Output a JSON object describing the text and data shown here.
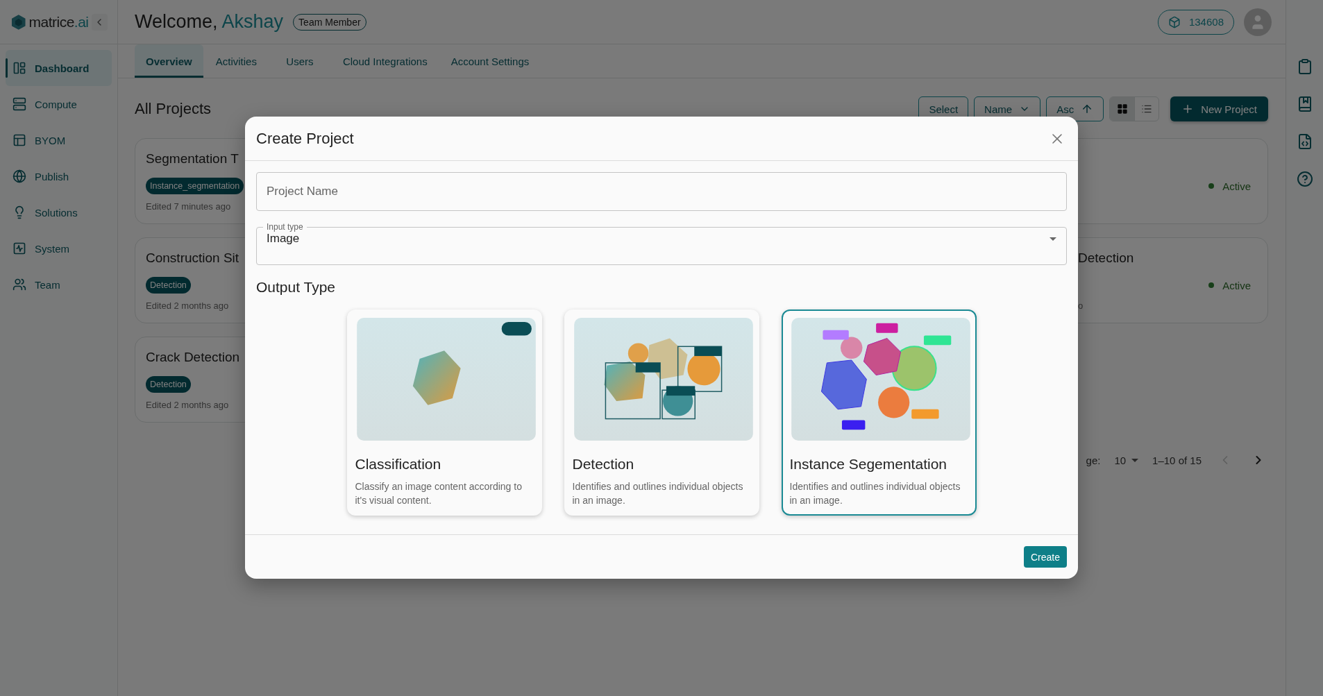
{
  "sidebar": {
    "logo": {
      "name": "matrice",
      "suffix": ".ai"
    },
    "items": [
      {
        "label": "Dashboard",
        "selected": true
      },
      {
        "label": "Compute",
        "selected": false
      },
      {
        "label": "BYOM",
        "selected": false
      },
      {
        "label": "Publish",
        "selected": false
      },
      {
        "label": "Solutions",
        "selected": false
      },
      {
        "label": "System",
        "selected": false
      },
      {
        "label": "Team",
        "selected": false
      }
    ]
  },
  "header": {
    "greeting": "Welcome,",
    "user": "Akshay",
    "role": "Team Member",
    "credits": "134608"
  },
  "tabs": [
    {
      "label": "Overview",
      "selected": true
    },
    {
      "label": "Activities",
      "selected": false
    },
    {
      "label": "Users",
      "selected": false
    },
    {
      "label": "Cloud Integrations",
      "selected": false
    },
    {
      "label": "Account Settings",
      "selected": false
    }
  ],
  "projects": {
    "title": "All Projects",
    "select": "Select",
    "sort_field": "Name",
    "sort_order": "Asc",
    "views": [
      {
        "kind": "grid",
        "selected": true
      },
      {
        "kind": "list",
        "selected": false
      }
    ],
    "new_button": "New Project",
    "left_column": [
      {
        "title": "Segmentation T",
        "tag": "Instance_segmentation",
        "edited": "Edited 7 minutes ago"
      },
      {
        "title": "Construction Sit",
        "tag": "Detection",
        "edited": "Edited 2 months ago"
      },
      {
        "title": "Crack Detection",
        "tag": "Detection",
        "edited": "Edited 2 months ago"
      }
    ],
    "right_column": [
      {
        "status": "Active"
      },
      {
        "title": "Detection",
        "status": "Active",
        "edited": "o"
      }
    ],
    "pagination": {
      "rows_label": "ge:",
      "rows": "10",
      "range": "1–10 of 15",
      "prev_disabled": true,
      "next_disabled": false
    }
  },
  "dialog": {
    "title": "Create Project",
    "name_placeholder": "Project Name",
    "input_type": {
      "label": "Input type",
      "value": "Image"
    },
    "output_label": "Output Type",
    "options": [
      {
        "kind": "classification",
        "title": "Classification",
        "description": "Classify an image content according to it's visual content.",
        "selected": false
      },
      {
        "kind": "detection",
        "title": "Detection",
        "description": "Identifies and outlines individual objects in an image.",
        "selected": false
      },
      {
        "kind": "segmentation",
        "title": "Instance Segementation",
        "description": "Identifies and outlines individual objects in an image.",
        "selected": true
      }
    ],
    "create": "Create"
  }
}
